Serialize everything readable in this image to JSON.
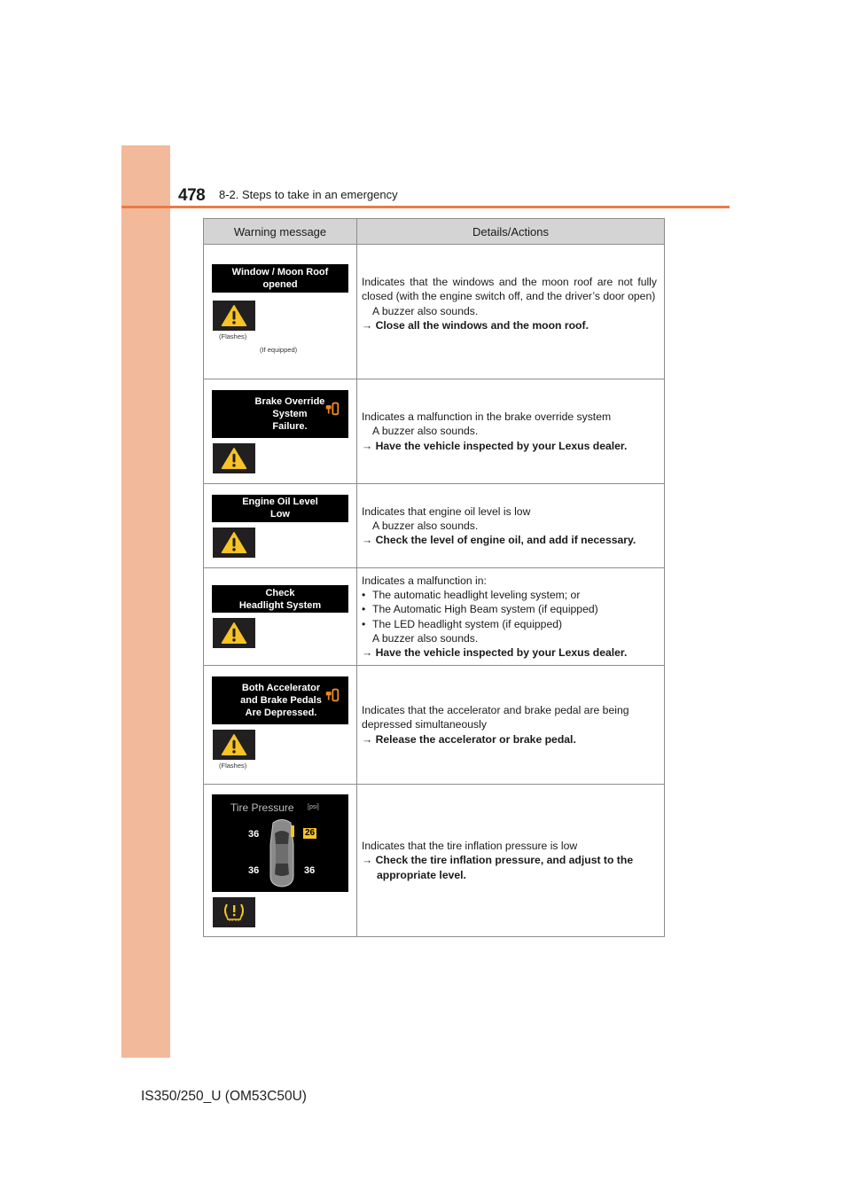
{
  "header": {
    "page_number": "478",
    "section_title": "8-2. Steps to take in an emergency"
  },
  "table": {
    "columns": [
      "Warning message",
      "Details/Actions"
    ],
    "rows": [
      {
        "message": [
          "Window / Moon Roof",
          "opened"
        ],
        "icon": "warning-triangle-icon",
        "icon_note": "(Flashes)",
        "extra_note": "(If equipped)",
        "details": [
          "Indicates that the windows and the moon roof are not fully closed (with the engine switch off, and the driver’s door open)"
        ],
        "buzzer": "A buzzer also sounds.",
        "action": "→ Close all the windows and the moon roof."
      },
      {
        "message": [
          "Brake Override",
          "System",
          "Failure."
        ],
        "icon": "warning-triangle-icon",
        "details": [
          "Indicates a malfunction in the brake override system"
        ],
        "buzzer": "A buzzer also sounds.",
        "action": "→ Have the vehicle inspected by your Lexus dealer."
      },
      {
        "message": [
          "Engine Oil Level",
          "Low"
        ],
        "icon": "warning-triangle-icon",
        "details": [
          "Indicates that engine oil level is low"
        ],
        "buzzer": "A buzzer also sounds.",
        "action": "→ Check the level of engine oil, and add if necessary."
      },
      {
        "message": [
          "Check",
          "Headlight System"
        ],
        "icon": "warning-triangle-icon",
        "details": [
          "Indicates a malfunction in:"
        ],
        "bullets": [
          "The automatic headlight leveling system; or",
          "The Automatic High Beam system (if equipped)",
          "The LED headlight system (if equipped)"
        ],
        "bullet_char": "•",
        "buzzer": "A buzzer also sounds.",
        "action": "→ Have the vehicle inspected by your Lexus dealer."
      },
      {
        "message": [
          "Both Accelerator",
          "and Brake Pedals",
          "Are Depressed."
        ],
        "icon": "warning-triangle-icon",
        "icon_note": "(Flashes)",
        "details": [
          "Indicates that the accelerator and brake pedal are being depressed simultaneously"
        ],
        "action": "→ Release the accelerator or brake pedal."
      },
      {
        "display": {
          "title": "Tire Pressure",
          "unit": "[psi]",
          "front_left": "36",
          "front_right": "26",
          "rear_left": "36",
          "rear_right": "36"
        },
        "icon": "tire-pressure-warning-icon",
        "details": [
          "Indicates that the tire inflation pressure is low"
        ],
        "action_line1": "→ Check the tire inflation pressure, and adjust to the",
        "action_line2": "appropriate level."
      }
    ]
  },
  "footer": {
    "model_code": "IS350/250_U (OM53C50U)"
  },
  "colors": {
    "sidebar": "#f2b99b",
    "rule": "#ec7b44",
    "warning_yellow": "#f7c325",
    "pedal_orange": "#f08a1f"
  }
}
